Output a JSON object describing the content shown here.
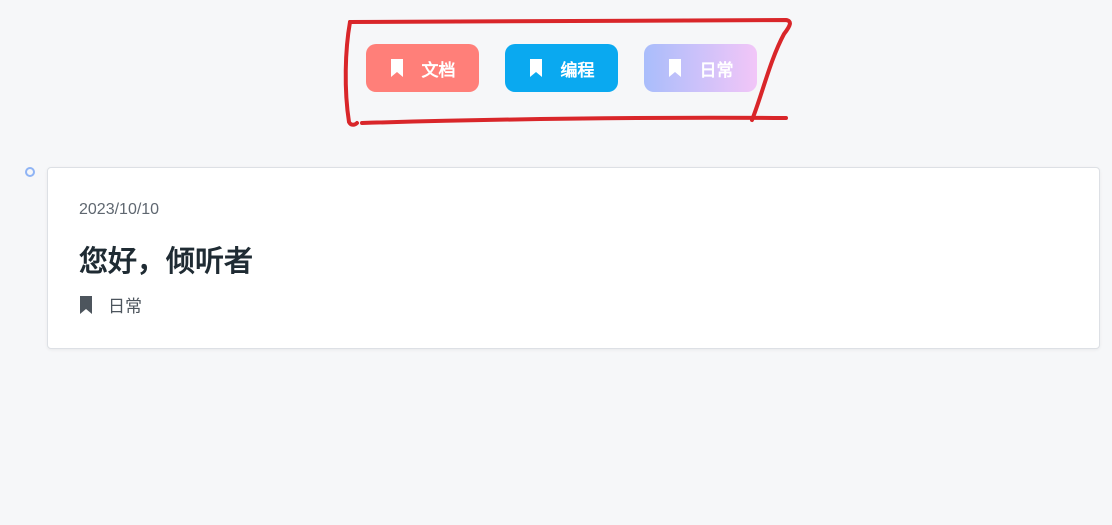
{
  "categories": [
    {
      "label": "文档",
      "icon": "bookmark-icon",
      "color": "#ff7f79"
    },
    {
      "label": "编程",
      "icon": "bookmark-icon",
      "color": "#0aa9f0"
    },
    {
      "label": "日常",
      "icon": "bookmark-icon",
      "gradient": [
        "#a9bdfb",
        "#f2c6f8"
      ]
    }
  ],
  "annotation": {
    "color": "#d9262a"
  },
  "post": {
    "date": "2023/10/10",
    "title": "您好，倾听者",
    "tag": {
      "label": "日常",
      "icon": "bookmark-icon"
    }
  }
}
